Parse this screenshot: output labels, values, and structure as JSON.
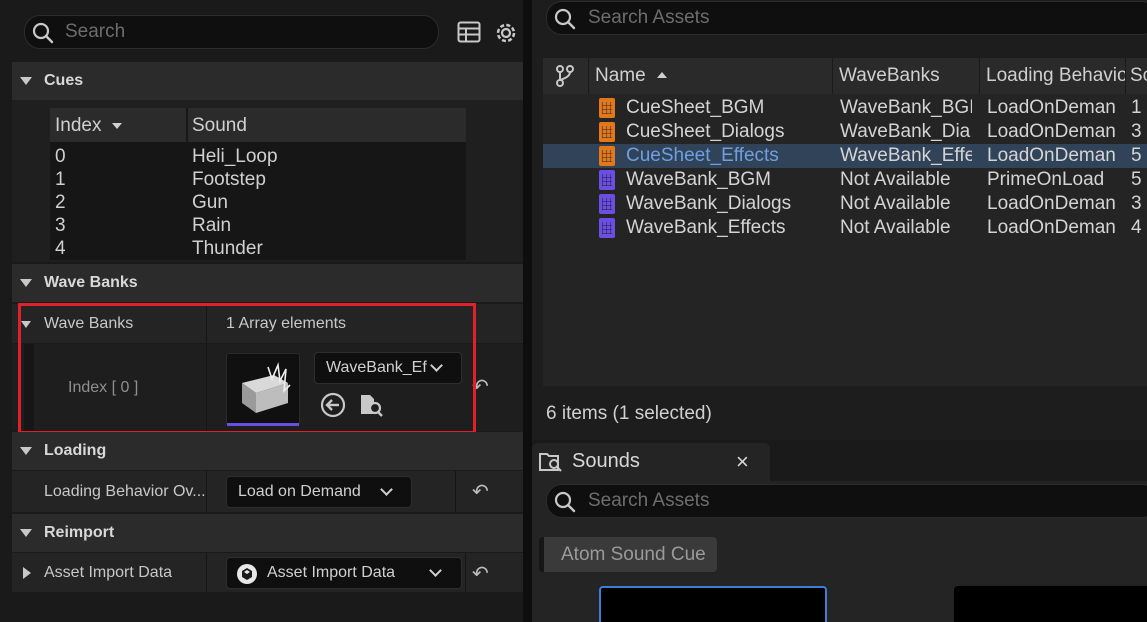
{
  "details": {
    "search_placeholder": "Search",
    "cues": {
      "section_label": "Cues",
      "columns": {
        "index": "Index",
        "sound": "Sound"
      },
      "rows": [
        {
          "index": "0",
          "sound": "Heli_Loop"
        },
        {
          "index": "1",
          "sound": "Footstep"
        },
        {
          "index": "2",
          "sound": "Gun"
        },
        {
          "index": "3",
          "sound": "Rain"
        },
        {
          "index": "4",
          "sound": "Thunder"
        }
      ]
    },
    "wave_banks": {
      "section_label": "Wave Banks",
      "property_label": "Wave Banks",
      "array_summary": "1 Array elements",
      "element_label": "Index [ 0 ]",
      "asset_value": "WaveBank_Ef"
    },
    "loading": {
      "section_label": "Loading",
      "property_label": "Loading Behavior Ov...",
      "value": "Load on Demand"
    },
    "reimport": {
      "section_label": "Reimport",
      "property_label": "Asset Import Data",
      "value": "Asset Import Data"
    },
    "highlight_color": "#e0202a"
  },
  "assets": {
    "search_placeholder": "Search Assets",
    "columns": {
      "name": "Name",
      "wavebanks": "WaveBanks",
      "loading": "Loading Behavio",
      "extra": "Sc"
    },
    "rows": [
      {
        "name": "CueSheet_BGM",
        "wavebanks": "WaveBank_BGI",
        "loading": "LoadOnDeman",
        "extra": "1",
        "icon": "orange",
        "selected": false
      },
      {
        "name": "CueSheet_Dialogs",
        "wavebanks": "WaveBank_Dia",
        "loading": "LoadOnDeman",
        "extra": "3",
        "icon": "orange",
        "selected": false
      },
      {
        "name": "CueSheet_Effects",
        "wavebanks": "WaveBank_Effe",
        "loading": "LoadOnDeman",
        "extra": "5",
        "icon": "orange",
        "selected": true
      },
      {
        "name": "WaveBank_BGM",
        "wavebanks": "Not Available",
        "loading": "PrimeOnLoad",
        "extra": "5",
        "icon": "purple",
        "selected": false
      },
      {
        "name": "WaveBank_Dialogs",
        "wavebanks": "Not Available",
        "loading": "LoadOnDeman",
        "extra": "3",
        "icon": "purple",
        "selected": false
      },
      {
        "name": "WaveBank_Effects",
        "wavebanks": "Not Available",
        "loading": "LoadOnDeman",
        "extra": "4",
        "icon": "purple",
        "selected": false
      }
    ],
    "status": "6 items (1 selected)"
  },
  "sounds": {
    "tab_label": "Sounds",
    "close_glyph": "×",
    "search_placeholder": "Search Assets",
    "filter_chip": "Atom Sound Cue"
  }
}
